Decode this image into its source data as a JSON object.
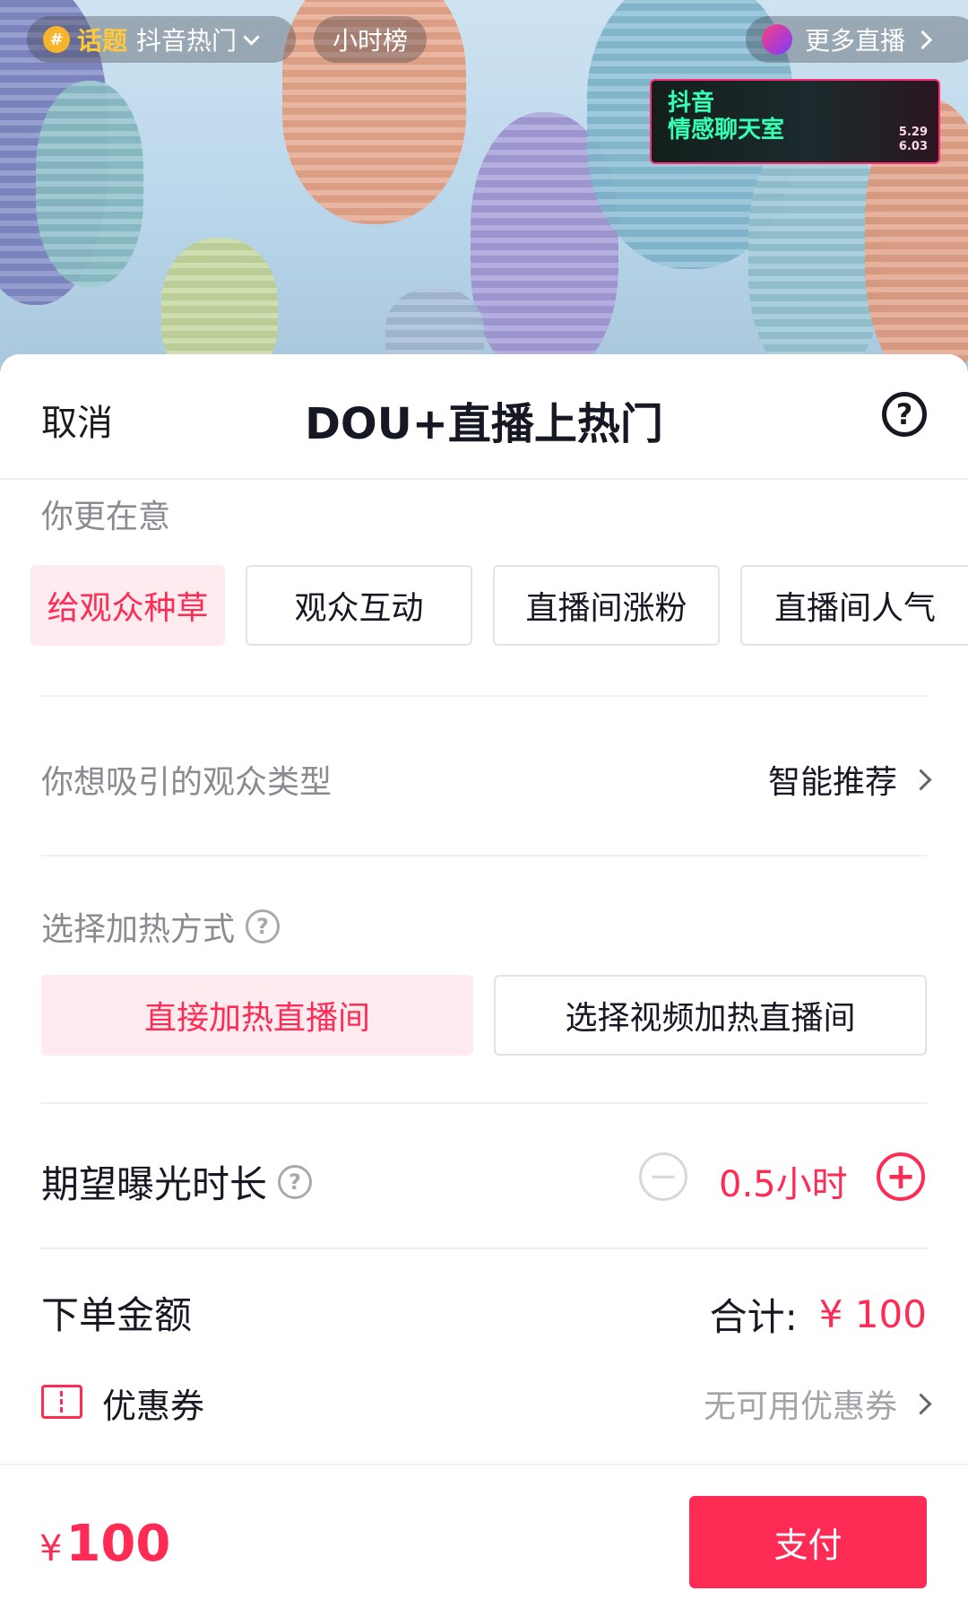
{
  "stream_overlay": {
    "topic_badge": "#",
    "topic_label": "话题",
    "topic_name": "抖音热门",
    "hour_rank": "小时榜",
    "more_live": "更多直播",
    "banner_line1": "抖音",
    "banner_line2": "情感聊天室",
    "banner_date1": "5.29",
    "banner_date2": "6.03"
  },
  "sheet": {
    "cancel": "取消",
    "title": "DOU+直播上热门",
    "help_icon": "question-circle-icon"
  },
  "goal": {
    "label": "你更在意",
    "options": [
      "给观众种草",
      "观众互动",
      "直播间涨粉",
      "直播间人气"
    ],
    "selected_index": 0
  },
  "audience": {
    "label": "你想吸引的观众类型",
    "value": "智能推荐"
  },
  "boost_mode": {
    "label": "选择加热方式",
    "options": [
      "直接加热直播间",
      "选择视频加热直播间"
    ],
    "selected_index": 0
  },
  "duration": {
    "label": "期望曝光时长",
    "value": "0.5小时"
  },
  "order": {
    "label": "下单金额",
    "total_label": "合计:",
    "total_value": "¥ 100"
  },
  "coupon": {
    "label": "优惠券",
    "value": "无可用优惠券"
  },
  "footer": {
    "currency": "¥",
    "amount": "100",
    "pay": "支付"
  },
  "colors": {
    "accent": "#fe2c55",
    "accent_bg": "#fdebef",
    "muted_text": "#8a8b91"
  }
}
